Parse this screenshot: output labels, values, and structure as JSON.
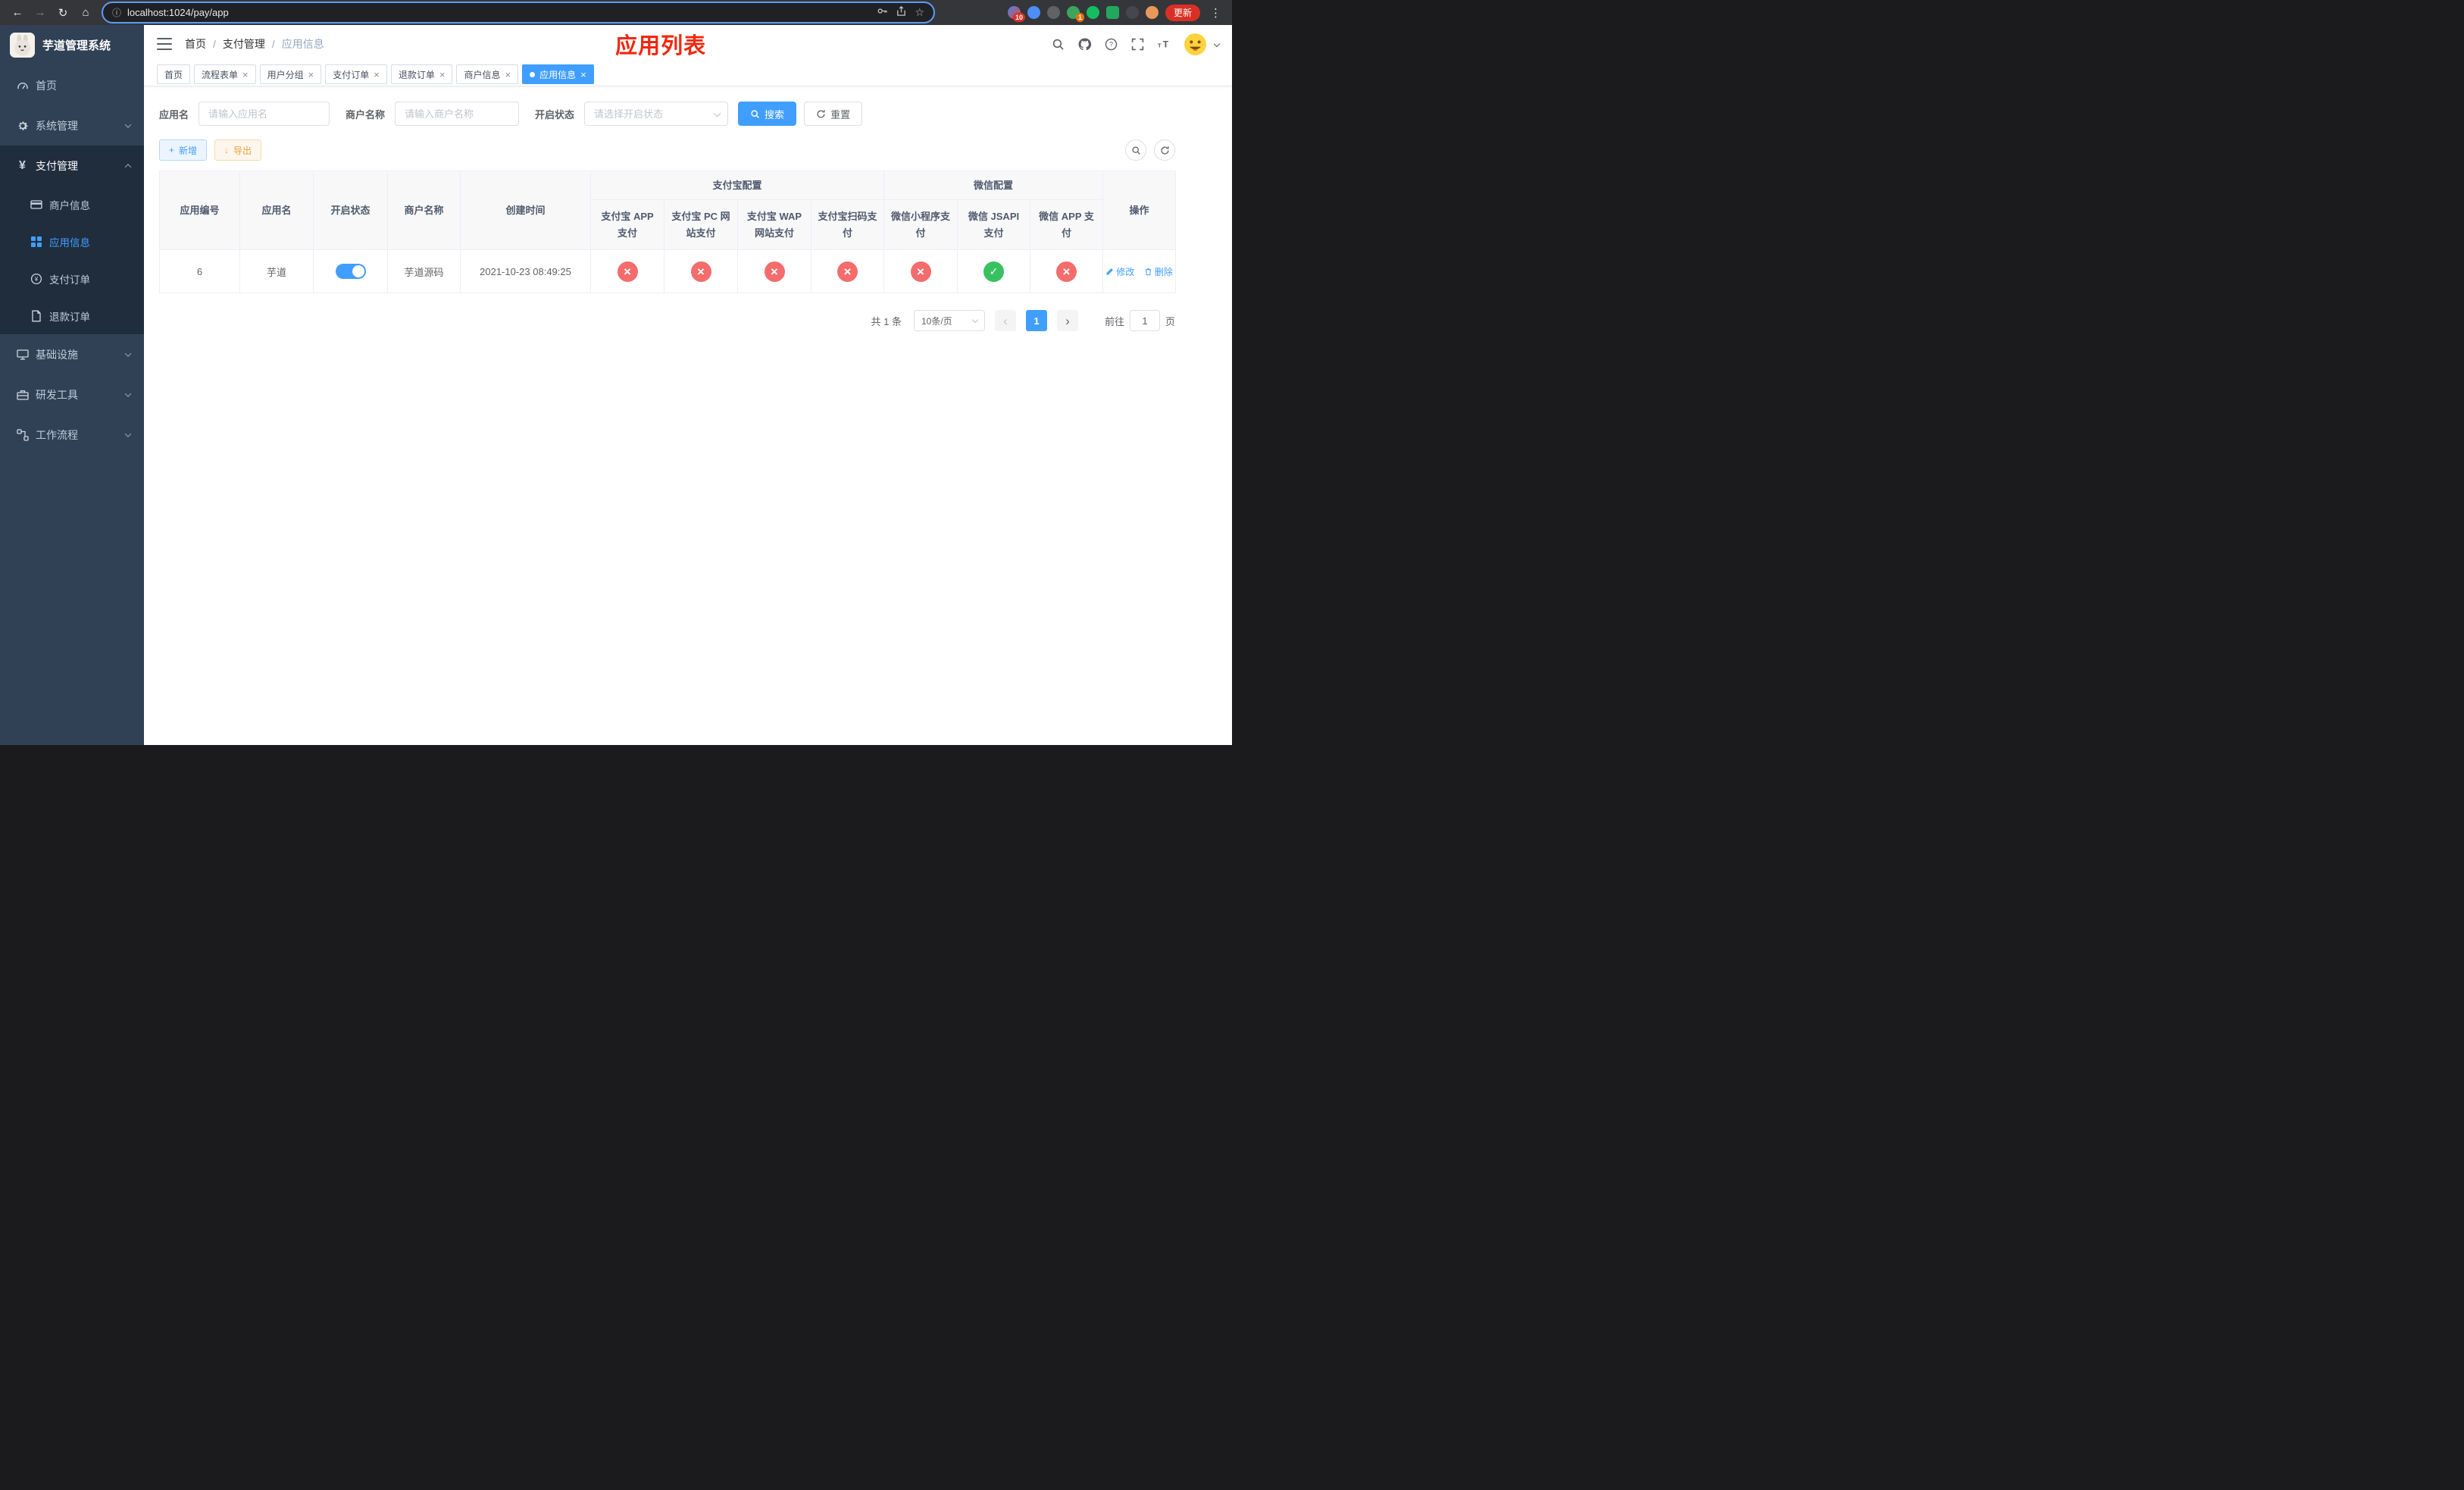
{
  "colors": {
    "accent": "#409eff",
    "success": "#38c160",
    "danger": "#f56c6c",
    "warning": "#e6a23c",
    "page_title_red": "#f2270c",
    "sidebar_bg": "#304156",
    "sidebar_submenu_bg": "#1f2d3d"
  },
  "icons": {
    "back": "←",
    "forward": "→",
    "reload": "↻",
    "home": "⌂",
    "info": "ⓘ",
    "star": "☆",
    "more": "⋮",
    "close": "×",
    "plus": "+",
    "download": "↓",
    "prev": "‹",
    "next": "›",
    "check": "✓",
    "cross": "×"
  },
  "browser": {
    "url": "localhost:1024/pay/app",
    "update_label": "更新",
    "ext_badge_1": "10",
    "ext_badge_2": "1"
  },
  "sidebar": {
    "title": "芋道管理系统",
    "home": "首页",
    "system": "系统管理",
    "payment": "支付管理",
    "merchant_info": "商户信息",
    "app_info": "应用信息",
    "pay_order": "支付订单",
    "refund_order": "退款订单",
    "infra": "基础设施",
    "dev_tools": "研发工具",
    "workflow": "工作流程"
  },
  "header": {
    "breadcrumb": [
      "首页",
      "支付管理",
      "应用信息"
    ],
    "separator": "/",
    "page_title": "应用列表"
  },
  "tabs": [
    {
      "label": "首页"
    },
    {
      "label": "流程表单"
    },
    {
      "label": "用户分组"
    },
    {
      "label": "支付订单"
    },
    {
      "label": "退款订单"
    },
    {
      "label": "商户信息"
    },
    {
      "label": "应用信息"
    }
  ],
  "filters": {
    "app_name_label": "应用名",
    "app_name_placeholder": "请输入应用名",
    "merchant_label": "商户名称",
    "merchant_placeholder": "请输入商户名称",
    "status_label": "开启状态",
    "status_placeholder": "请选择开启状态",
    "search_label": "搜索",
    "reset_label": "重置"
  },
  "toolbar": {
    "add_label": "新增",
    "export_label": "导出"
  },
  "table": {
    "main_headers": [
      "应用编号",
      "应用名",
      "开启状态",
      "商户名称",
      "创建时间"
    ],
    "group_headers": [
      "支付宝配置",
      "微信配置"
    ],
    "sub_headers": [
      "支付宝 APP 支付",
      "支付宝 PC 网站支付",
      "支付宝 WAP 网站支付",
      "支付宝扫码支付",
      "微信小程序支付",
      "微信 JSAPI 支付",
      "微信 APP 支付"
    ],
    "ops_header": "操作",
    "rows": [
      {
        "app_id": "6",
        "app_name": "芋道",
        "enabled": true,
        "merchant_name": "芋道源码",
        "create_time": "2021-10-23 08:49:25",
        "alipay_app": false,
        "alipay_pc": false,
        "alipay_wap": false,
        "alipay_qr": false,
        "wechat_mini": false,
        "wechat_jsapi": true,
        "wechat_app": false,
        "edit_label": "修改",
        "delete_label": "删除"
      }
    ]
  },
  "pagination": {
    "total_label": "共 1 条",
    "page_size": "10条/页",
    "current_page": "1",
    "goto_prefix": "前往",
    "goto_value": "1",
    "goto_suffix": "页"
  }
}
